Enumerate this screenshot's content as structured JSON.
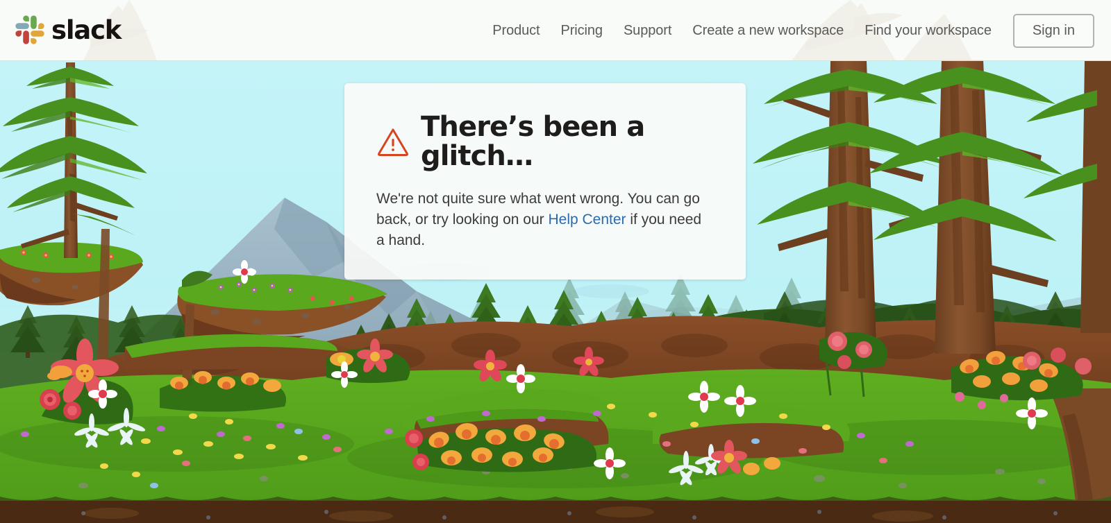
{
  "page": {
    "title": "There's been a glitch… | Slack",
    "background_scene": "forest-meadow-illustration"
  },
  "header": {
    "logo_text": "slack",
    "logo_icon": "slack-logo-icon",
    "logo_colors": [
      "#6ecadc",
      "#e9a820",
      "#e01e5a",
      "#2eb67d"
    ],
    "nav_items": [
      {
        "label": "Product"
      },
      {
        "label": "Pricing"
      },
      {
        "label": "Support"
      },
      {
        "label": "Create a new workspace"
      },
      {
        "label": "Find your workspace"
      }
    ],
    "sign_in_label": "Sign in",
    "background_color": "#fcfbf8",
    "text_color": "#5b5a57"
  },
  "error_card": {
    "icon": "warning-triangle-icon",
    "icon_color": "#d5451f",
    "title": "There’s been a glitch…",
    "body_before_link": "We're not quite sure what went wrong. You can go back, or try looking on our ",
    "link_label": "Help Center",
    "body_after_link": " if you need a hand.",
    "link_color": "#2a6aad",
    "title_color": "#1f1d1b",
    "body_color": "#3d3b39",
    "background_color": "#fcfcfa"
  },
  "scene": {
    "sky_color": "#bdf3f7",
    "mountain_color": "#9ab4c4",
    "grass_color": "#5aa81e",
    "soil_color": "#5a3318",
    "forest_dark": "#2d5418",
    "forest_mid": "#3f7a1f",
    "trunk_color": "#7a4a26"
  }
}
